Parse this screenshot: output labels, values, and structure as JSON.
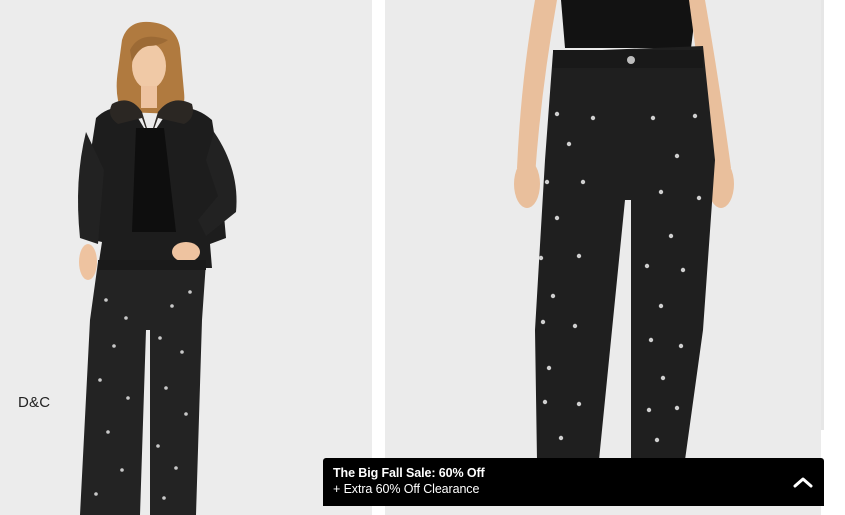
{
  "product_gallery": {
    "images": [
      {
        "name": "Model wearing black leather jacket and embellished black jeans"
      },
      {
        "name": "Close-up of embellished black straight jeans"
      }
    ]
  },
  "brand_label": "D&C",
  "promo": {
    "title": "The Big Fall Sale: 60% Off",
    "subtitle": "+ Extra 60% Off Clearance",
    "toggle_icon": "chevron-up-icon"
  },
  "colors": {
    "promo_background": "#000000",
    "promo_text": "#ffffff",
    "photo_background": "#ececec"
  }
}
